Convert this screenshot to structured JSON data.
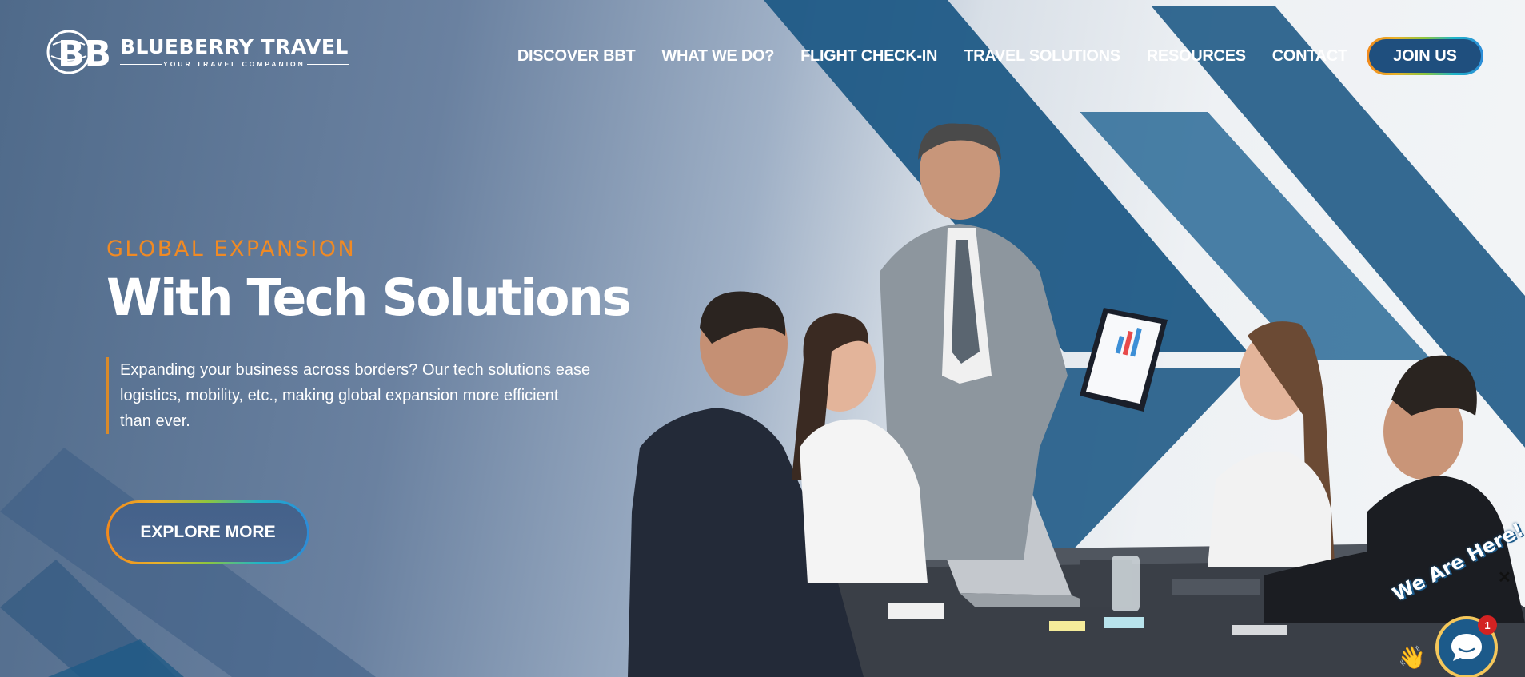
{
  "brand": {
    "monogram": "BB",
    "name": "BLUEBERRY TRAVEL",
    "tagline": "YOUR TRAVEL COMPANION"
  },
  "nav": {
    "items": [
      {
        "label": "DISCOVER BBT"
      },
      {
        "label": "WHAT WE DO?"
      },
      {
        "label": "FLIGHT CHECK-IN"
      },
      {
        "label": "TRAVEL SOLUTIONS"
      },
      {
        "label": "RESOURCES"
      },
      {
        "label": "CONTACT"
      }
    ],
    "cta": "JOIN US"
  },
  "hero": {
    "eyebrow": "GLOBAL EXPANSION",
    "headline": "With Tech Solutions",
    "description": "Expanding your business across borders? Our tech solutions ease logistics, mobility, etc., making global expansion more efficient than ever.",
    "cta": "EXPLORE MORE"
  },
  "chat": {
    "prompt": "We Are Here!",
    "badge_count": "1",
    "close_glyph": "✕",
    "wave_glyph": "👋"
  },
  "colors": {
    "accent_orange": "#f08a24",
    "brand_blue": "#1c5a8a",
    "stripe_blue": "#1f5a86",
    "gradient_border": [
      "#f2891c",
      "#e9b12a",
      "#8dc63f",
      "#1fb4c9",
      "#2d8bd8"
    ]
  },
  "icons": {
    "logo": "globe-bb-logo",
    "chat": "chat-bubble-icon",
    "close": "close-icon",
    "wave": "waving-hand-icon"
  }
}
